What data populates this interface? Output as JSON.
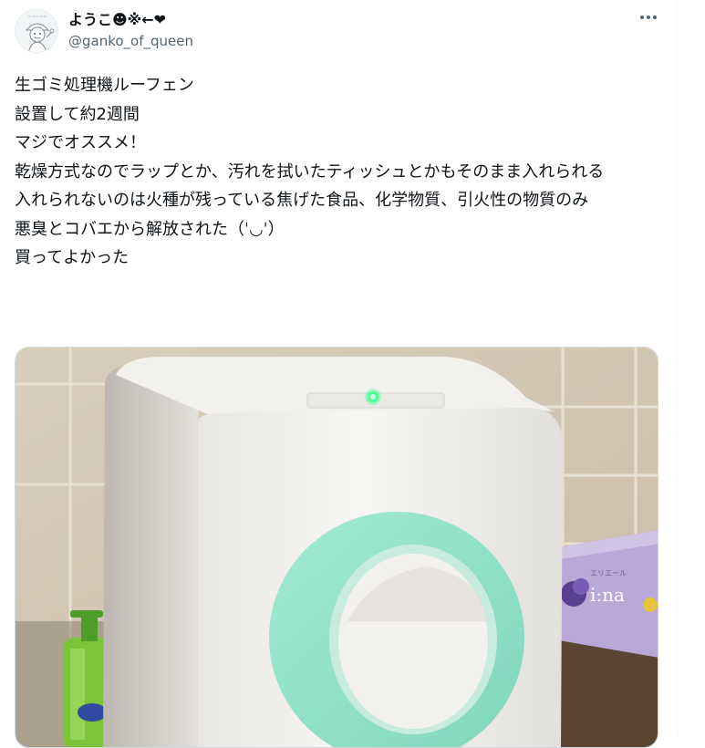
{
  "author": {
    "display_name": "ようこ☻※←❤",
    "handle": "@ganko_of_queen",
    "avatar_icon": "avatar-illustration"
  },
  "menu": {
    "icon": "more-icon"
  },
  "tweet": {
    "lines": [
      "生ゴミ処理機ルーフェン",
      "設置して約2週間",
      "マジでオススメ！",
      "乾燥方式なのでラップとか、汚れを拭いたティッシュとかもそのまま入れられる",
      "入れられないのは火種が残っている焦げた食品、化学物質、引火性の物質のみ",
      "悪臭とコバエから解放された（ˈ◡ˈ）",
      "買ってよかった"
    ]
  },
  "media": {
    "box_text": "エリエール",
    "box_brand": "i:na"
  },
  "colors": {
    "text": "#0f1419",
    "secondary": "#536471",
    "border": "#cfd9de",
    "appliance_mint": "#8ee0c6",
    "led_green": "#39ff8a"
  }
}
